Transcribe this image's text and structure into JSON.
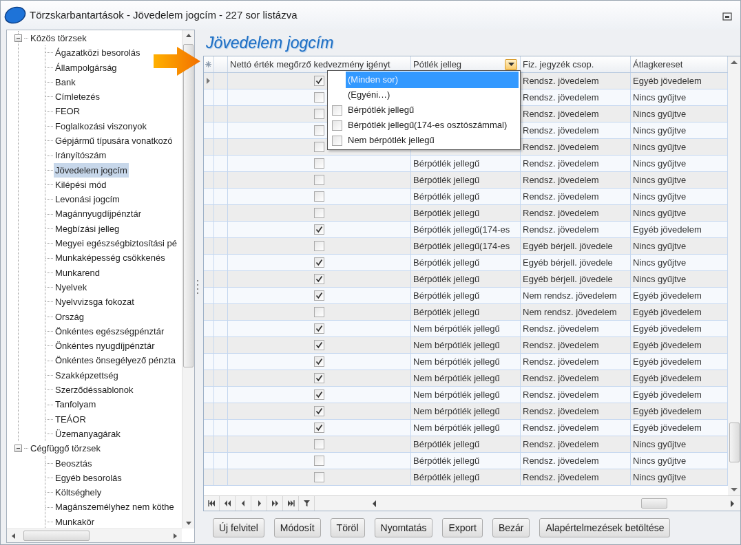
{
  "window": {
    "title": "Törzskarbantartások - Jövedelem jogcím - 227 sor listázva"
  },
  "tree": {
    "items": [
      {
        "label": "Közös törzsek",
        "expanded": true,
        "selected": false,
        "children": [
          {
            "label": "Ágazatközi besorolás",
            "selected": false
          },
          {
            "label": "Állampolgárság",
            "selected": false
          },
          {
            "label": "Bank",
            "selected": false
          },
          {
            "label": "Címletezés",
            "selected": false
          },
          {
            "label": "FEOR",
            "selected": false
          },
          {
            "label": "Foglalkozási viszonyok",
            "selected": false
          },
          {
            "label": "Gépjármű típusára vonatkozó",
            "selected": false
          },
          {
            "label": "Irányítószám",
            "selected": false
          },
          {
            "label": "Jövedelem jogcím",
            "selected": true
          },
          {
            "label": "Kilépési mód",
            "selected": false
          },
          {
            "label": "Levonási jogcím",
            "selected": false
          },
          {
            "label": "Magánnyugdíjpénztár",
            "selected": false
          },
          {
            "label": "Megbízási jelleg",
            "selected": false
          },
          {
            "label": "Megyei egészségbiztosítási pé",
            "selected": false
          },
          {
            "label": "Munkaképesség csökkenés",
            "selected": false
          },
          {
            "label": "Munkarend",
            "selected": false
          },
          {
            "label": "Nyelvek",
            "selected": false
          },
          {
            "label": "Nyelvvizsga fokozat",
            "selected": false
          },
          {
            "label": "Ország",
            "selected": false
          },
          {
            "label": "Önkéntes egészségpénztár",
            "selected": false
          },
          {
            "label": "Önkéntes nyugdíjpénztár",
            "selected": false
          },
          {
            "label": "Önkéntes önsegélyező pénzta",
            "selected": false
          },
          {
            "label": "Szakképzettség",
            "selected": false
          },
          {
            "label": "Szerződéssablonok",
            "selected": false
          },
          {
            "label": "Tanfolyam",
            "selected": false
          },
          {
            "label": "TEÁOR",
            "selected": false
          },
          {
            "label": "Üzemanyagárak",
            "selected": false
          }
        ]
      },
      {
        "label": "Cégfüggő törzsek",
        "expanded": true,
        "selected": false,
        "children": [
          {
            "label": "Beosztás",
            "selected": false
          },
          {
            "label": "Egyéb besorolás",
            "selected": false
          },
          {
            "label": "Költséghely",
            "selected": false
          },
          {
            "label": "Magánszemélyhez nem köthe",
            "selected": false
          },
          {
            "label": "Munkakör",
            "selected": false
          }
        ]
      }
    ]
  },
  "panel_title": "Jövedelem jogcím",
  "grid": {
    "columns": [
      "Nettó érték megőrző kedvezmény igényt",
      "Pótlék jelleg",
      "Fiz. jegyzék csop.",
      "Átlagkereset"
    ],
    "rows": [
      {
        "selected": true,
        "checked": true,
        "fiz": "Rendsz. jövedelem",
        "atlag": "Egyéb jövedelem"
      },
      {
        "selected": false,
        "checked": false,
        "fiz": "Rendsz. jövedelem",
        "atlag": "Nincs gyűjtve"
      },
      {
        "selected": false,
        "checked": false,
        "fiz": "Rendsz. jövedelem",
        "atlag": "Nincs gyűjtve"
      },
      {
        "selected": false,
        "checked": false,
        "fiz": "Rendsz. jövedelem",
        "atlag": "Nincs gyűjtve"
      },
      {
        "selected": false,
        "checked": false,
        "fiz": "Rendsz. jövedelem",
        "atlag": "Nincs gyűjtve"
      },
      {
        "selected": false,
        "checked": false,
        "potlek": "Bérpótlék jellegű",
        "fiz": "Rendsz. jövedelem",
        "atlag": "Nincs gyűjtve"
      },
      {
        "selected": false,
        "checked": false,
        "potlek": "Bérpótlék jellegű",
        "fiz": "Rendsz. jövedelem",
        "atlag": "Nincs gyűjtve"
      },
      {
        "selected": false,
        "checked": false,
        "potlek": "Bérpótlék jellegű",
        "fiz": "Rendsz. jövedelem",
        "atlag": "Nincs gyűjtve"
      },
      {
        "selected": false,
        "checked": false,
        "potlek": "Bérpótlék jellegű",
        "fiz": "Rendsz. jövedelem",
        "atlag": "Nincs gyűjtve"
      },
      {
        "selected": false,
        "checked": true,
        "potlek": "Bérpótlék jellegű(174-es",
        "fiz": "Rendsz. jövedelem",
        "atlag": "Egyéb jövedelem"
      },
      {
        "selected": false,
        "checked": false,
        "potlek": "Bérpótlék jellegű(174-es",
        "fiz": "Egyéb bérjell. jövedele",
        "atlag": "Nincs gyűjtve"
      },
      {
        "selected": false,
        "checked": true,
        "potlek": "Bérpótlék jellegű",
        "fiz": "Egyéb bérjell. jövedele",
        "atlag": "Nincs gyűjtve"
      },
      {
        "selected": false,
        "checked": true,
        "potlek": "Bérpótlék jellegű",
        "fiz": "Egyéb bérjell. jövedele",
        "atlag": "Nincs gyűjtve"
      },
      {
        "selected": false,
        "checked": true,
        "potlek": "Bérpótlék jellegű",
        "fiz": "Nem rendsz. jövedelem",
        "atlag": "Egyéb jövedelem"
      },
      {
        "selected": false,
        "checked": false,
        "potlek": "Bérpótlék jellegű",
        "fiz": "Nem rendsz. jövedelem",
        "atlag": "Egyéb jövedelem"
      },
      {
        "selected": false,
        "checked": true,
        "potlek": "Nem bérpótlék jellegű",
        "fiz": "Rendsz. jövedelem",
        "atlag": "Egyéb jövedelem"
      },
      {
        "selected": false,
        "checked": true,
        "potlek": "Nem bérpótlék jellegű",
        "fiz": "Rendsz. jövedelem",
        "atlag": "Egyéb jövedelem"
      },
      {
        "selected": false,
        "checked": true,
        "potlek": "Nem bérpótlék jellegű",
        "fiz": "Rendsz. jövedelem",
        "atlag": "Egyéb jövedelem"
      },
      {
        "selected": false,
        "checked": true,
        "potlek": "Nem bérpótlék jellegű",
        "fiz": "Rendsz. jövedelem",
        "atlag": "Egyéb jövedelem"
      },
      {
        "selected": false,
        "checked": true,
        "potlek": "Nem bérpótlék jellegű",
        "fiz": "Rendsz. jövedelem",
        "atlag": "Egyéb jövedelem"
      },
      {
        "selected": false,
        "checked": true,
        "potlek": "Nem bérpótlék jellegű",
        "fiz": "Rendsz. jövedelem",
        "atlag": "Egyéb jövedelem"
      },
      {
        "selected": false,
        "checked": true,
        "potlek": "Nem bérpótlék jellegű",
        "fiz": "Rendsz. jövedelem",
        "atlag": "Egyéb jövedelem"
      },
      {
        "selected": false,
        "checked": false,
        "potlek": "Bérpótlék jellegű",
        "fiz": "Rendsz. jövedelem",
        "atlag": "Nincs gyűjtve"
      },
      {
        "selected": false,
        "checked": false,
        "potlek": "Bérpótlék jellegű",
        "fiz": "Rendsz. jövedelem",
        "atlag": "Nincs gyűjtve"
      },
      {
        "selected": false,
        "checked": false,
        "potlek": "Bérpótlék jellegű",
        "fiz": "Rendsz. jövedelem",
        "atlag": "Nincs gyűjtve"
      }
    ],
    "filter_popup": {
      "open": true,
      "items": [
        {
          "kind": "option",
          "label": "(Minden sor)",
          "selected": true
        },
        {
          "kind": "option",
          "label": "(Egyéni…)",
          "selected": false
        },
        {
          "kind": "check",
          "label": "Bérpótlék jellegű",
          "checked": false,
          "selected": false
        },
        {
          "kind": "check",
          "label": "Bérpótlék jellegű(174-es osztószámmal)",
          "checked": false,
          "selected": false
        },
        {
          "kind": "check",
          "label": "Nem bérpótlék jellegű",
          "checked": false,
          "selected": false
        }
      ]
    }
  },
  "buttons": [
    {
      "label": "Új felvitel"
    },
    {
      "label": "Módosít"
    },
    {
      "label": "Töröl"
    },
    {
      "label": "Nyomtatás"
    },
    {
      "label": "Export"
    },
    {
      "label": "Bezár"
    },
    {
      "label": "Alapértelmezések betöltése"
    }
  ]
}
